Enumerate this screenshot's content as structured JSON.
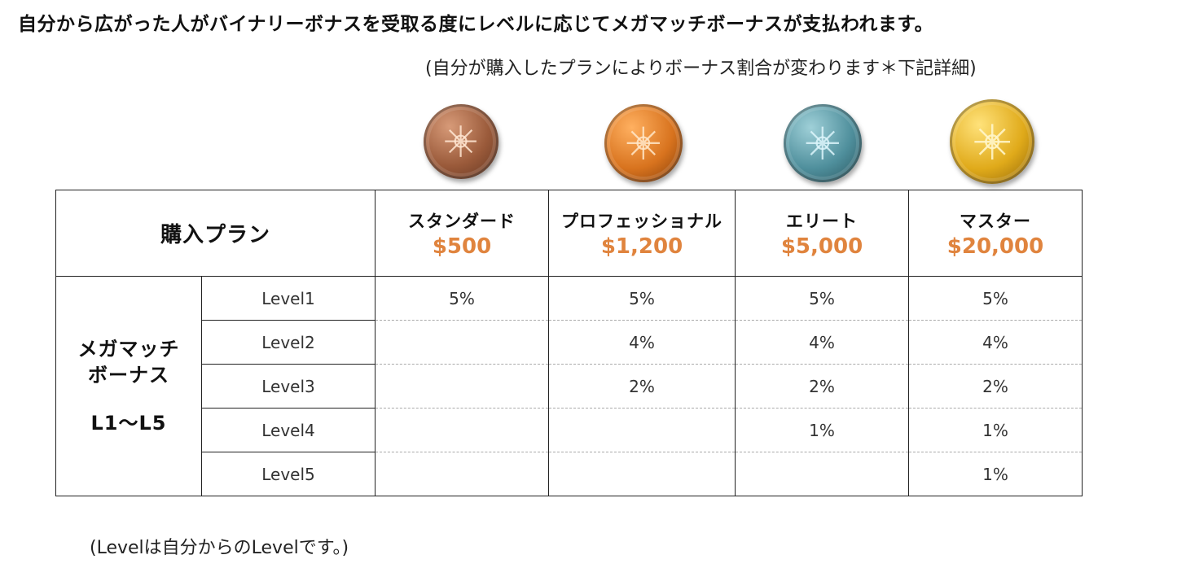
{
  "header": {
    "headline": "自分から広がった人がバイナリーボナスを受取る度にレベルに応じてメガマッチボーナスが支払われます。",
    "subline": "(自分が購入したプランによりボーナス割合が変わります＊下記詳細)"
  },
  "coins": [
    {
      "name": "bronze-coin-icon",
      "color": "#9a5a3a"
    },
    {
      "name": "copper-coin-icon",
      "color": "#d8731e"
    },
    {
      "name": "silver-coin-icon",
      "color": "#4f8f9c"
    },
    {
      "name": "gold-coin-icon",
      "color": "#e0aa1a"
    }
  ],
  "table": {
    "corner_label": "購入プラン",
    "plans": [
      {
        "name": "スタンダード",
        "price": "$500"
      },
      {
        "name": "プロフェッショナル",
        "price": "$1,200"
      },
      {
        "name": "エリート",
        "price": "$5,000"
      },
      {
        "name": "マスター",
        "price": "$20,000"
      }
    ],
    "bonus_label_line1": "メガマッチ",
    "bonus_label_line2": "ボーナス",
    "bonus_label_range": "L1～L5",
    "levels": [
      {
        "label": "Level1",
        "values": [
          "5%",
          "5%",
          "5%",
          "5%"
        ]
      },
      {
        "label": "Level2",
        "values": [
          "",
          "4%",
          "4%",
          "4%"
        ]
      },
      {
        "label": "Level3",
        "values": [
          "",
          "2%",
          "2%",
          "2%"
        ]
      },
      {
        "label": "Level4",
        "values": [
          "",
          "",
          "1%",
          "1%"
        ]
      },
      {
        "label": "Level5",
        "values": [
          "",
          "",
          "",
          "1%"
        ]
      }
    ]
  },
  "footnote": "(Levelは自分からのLevelです。)"
}
